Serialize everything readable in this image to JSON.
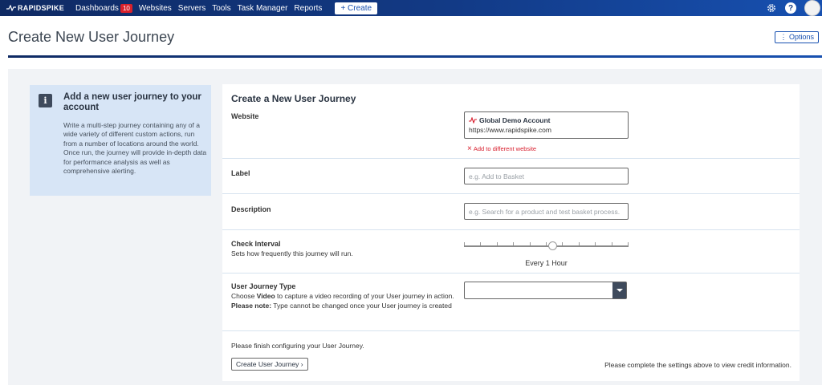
{
  "nav": {
    "brand": "RAPIDSPIKE",
    "items": [
      {
        "label": "Dashboards",
        "badge": "10"
      },
      {
        "label": "Websites"
      },
      {
        "label": "Servers"
      },
      {
        "label": "Tools"
      },
      {
        "label": "Task Manager"
      },
      {
        "label": "Reports"
      }
    ],
    "create_label": "+ Create",
    "icons": [
      "gear-icon",
      "help-icon",
      "avatar"
    ],
    "help_glyph": "?"
  },
  "header": {
    "title": "Create New User Journey",
    "options_label": "⋮ Options"
  },
  "info": {
    "icon_glyph": "i",
    "title": "Add a new user journey to your account",
    "body_1": "Write a multi-step journey containing any of a wide variety of different custom actions, run from a number of locations around the world.",
    "body_2": "Once run, the journey will provide in-depth data for performance analysis as well as comprehensive alerting."
  },
  "form": {
    "title": "Create a New User Journey",
    "website": {
      "label": "Website",
      "account_name": "Global Demo Account",
      "url": "https://www.rapidspike.com",
      "add_link": "Add to different website"
    },
    "label_field": {
      "label": "Label",
      "placeholder": "e.g. Add to Basket"
    },
    "description_field": {
      "label": "Description",
      "placeholder": "e.g. Search for a product and test basket process."
    },
    "check_interval": {
      "label": "Check Interval",
      "help": "Sets how frequently this journey will run.",
      "value_text": "Every 1 Hour",
      "position_fraction": 0.54
    },
    "journey_type": {
      "label": "User Journey Type",
      "help_prefix": "Choose ",
      "help_bold": "Video",
      "help_suffix": " to capture a video recording of your User journey in action.",
      "note_bold": "Please note:",
      "note_text": " Type cannot be changed once your User journey is created",
      "selected": ""
    },
    "footer_text": "Please finish configuring your User Journey.",
    "create_button": "Create User Journey ›",
    "credit_text": "Please complete the settings above to view credit information."
  },
  "colors": {
    "nav": "#123a86",
    "accent": "#1750b0",
    "error": "#d81e2d",
    "info_bg": "#d7e5f6"
  }
}
